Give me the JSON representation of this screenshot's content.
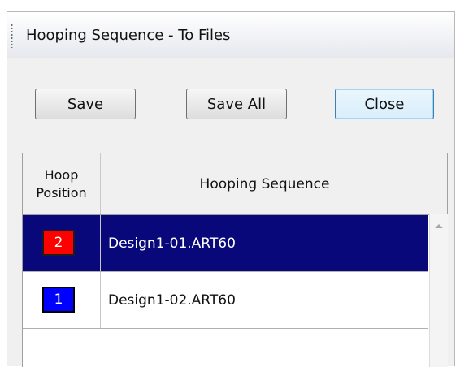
{
  "window": {
    "title": "Hooping Sequence - To Files"
  },
  "toolbar": {
    "save_label": "Save",
    "save_all_label": "Save All",
    "close_label": "Close"
  },
  "table": {
    "columns": [
      "Hoop\nPosition",
      "Hooping Sequence"
    ],
    "rows": [
      {
        "position": "2",
        "color": "#ff0000",
        "file": "Design1-01.ART60",
        "selected": true
      },
      {
        "position": "1",
        "color": "#0000ff",
        "file": "Design1-02.ART60",
        "selected": false
      }
    ]
  },
  "icons": {
    "scroll_up": "chevron-up-icon",
    "grip": "grip-dots-icon"
  }
}
